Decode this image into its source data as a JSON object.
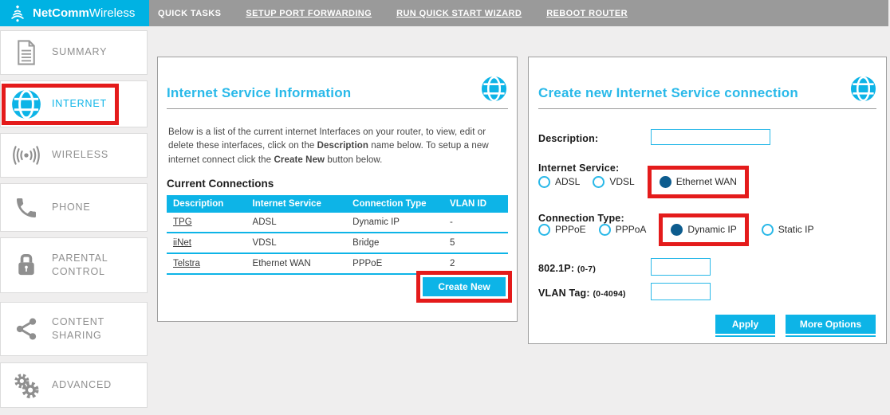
{
  "brand": {
    "name_bold": "NetComm",
    "name_light": "Wireless"
  },
  "topnav": {
    "items": [
      {
        "label": "QUICK TASKS",
        "underlined": false
      },
      {
        "label": "SETUP PORT FORWARDING",
        "underlined": true
      },
      {
        "label": "RUN QUICK START WIZARD",
        "underlined": true
      },
      {
        "label": "REBOOT ROUTER",
        "underlined": true
      }
    ]
  },
  "sidebar": {
    "items": [
      {
        "label": "SUMMARY",
        "icon": "document-icon",
        "active": false
      },
      {
        "label": "INTERNET",
        "icon": "globe-icon",
        "active": true,
        "highlighted": true
      },
      {
        "label": "WIRELESS",
        "icon": "wifi-signal-icon",
        "active": false
      },
      {
        "label": "PHONE",
        "icon": "phone-icon",
        "active": false
      },
      {
        "label": "PARENTAL CONTROL",
        "icon": "lock-icon",
        "active": false
      },
      {
        "label": "CONTENT SHARING",
        "icon": "share-icon",
        "active": false
      },
      {
        "label": "ADVANCED",
        "icon": "gears-icon",
        "active": false
      }
    ]
  },
  "panels": {
    "info": {
      "title": "Internet Service Information",
      "intro": [
        "Below is a list of the current internet Interfaces on your router, to view, edit or delete these interfaces, click on the ",
        "Description",
        " name below. To setup a new internet connect click the ",
        "Create New",
        " button below."
      ],
      "subtitle": "Current Connections",
      "table": {
        "headers": [
          "Description",
          "Internet Service",
          "Connection Type",
          "VLAN ID"
        ],
        "rows": [
          [
            "TPG",
            "ADSL",
            "Dynamic IP",
            "-"
          ],
          [
            "iiNet",
            "VDSL",
            "Bridge",
            "5"
          ],
          [
            "Telstra",
            "Ethernet WAN",
            "PPPoE",
            "2"
          ]
        ]
      },
      "create_button": "Create New"
    },
    "create": {
      "title": "Create new Internet Service connection",
      "description_label": "Description:",
      "description_value": "",
      "internet_service_label": "Internet Service:",
      "internet_service_options": [
        {
          "label": "ADSL",
          "selected": false,
          "highlighted": false
        },
        {
          "label": "VDSL",
          "selected": false,
          "highlighted": false
        },
        {
          "label": "Ethernet WAN",
          "selected": true,
          "highlighted": true
        }
      ],
      "connection_type_label": "Connection Type:",
      "connection_type_options": [
        {
          "label": "PPPoE",
          "selected": false,
          "highlighted": false
        },
        {
          "label": "PPPoA",
          "selected": false,
          "highlighted": false
        },
        {
          "label": "Dynamic IP",
          "selected": true,
          "highlighted": true
        },
        {
          "label": "Static IP",
          "selected": false,
          "highlighted": false
        }
      ],
      "fields": [
        {
          "label": "802.1P:",
          "hint": "(0-7)",
          "value": ""
        },
        {
          "label": "VLAN Tag:",
          "hint": "(0-4094)",
          "value": ""
        }
      ],
      "apply_button": "Apply",
      "more_options_button": "More Options"
    }
  },
  "colors": {
    "brand_cyan": "#00b2e3",
    "accent_cyan": "#0db4e7",
    "title_cyan": "#29b9e9",
    "nav_gray": "#9a9a9a",
    "highlight_red": "#e41b1b",
    "selected_radio_navy": "#0d5c8e",
    "page_background": "#efeeee"
  }
}
